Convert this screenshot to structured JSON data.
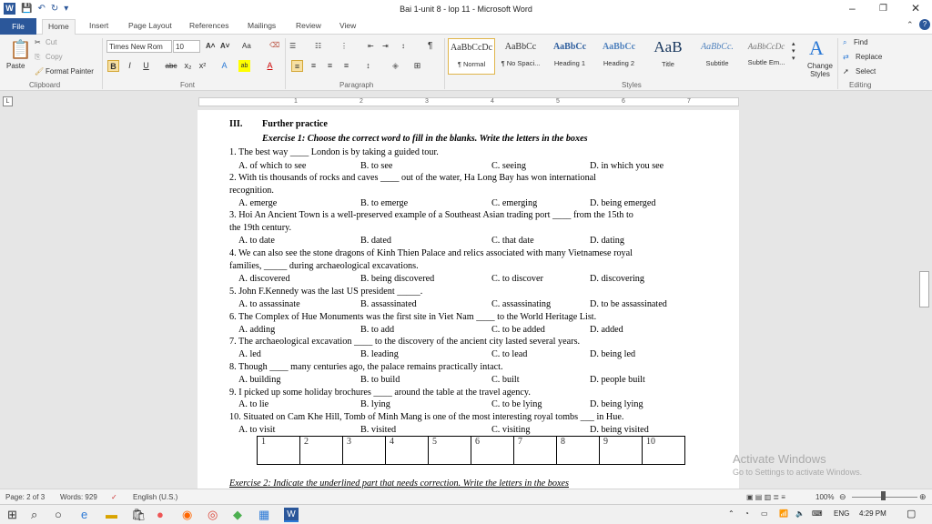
{
  "window": {
    "title": "Bai 1-unit 8 - lop 11  -  Microsoft Word",
    "minimize": "–",
    "restore": "❐",
    "close": "✕"
  },
  "tabs": [
    "File",
    "Home",
    "Insert",
    "Page Layout",
    "References",
    "Mailings",
    "Review",
    "View"
  ],
  "ribbon": {
    "clipboard": {
      "paste": "Paste",
      "cut": "Cut",
      "copy": "Copy",
      "format_painter": "Format Painter",
      "label": "Clipboard"
    },
    "font": {
      "name": "Times New Rom",
      "size": "10",
      "label": "Font",
      "grow": "A˄",
      "shrink": "A˅",
      "case": "Aa",
      "bold": "B",
      "italic": "I",
      "underline": "U",
      "strike": "abc",
      "sub": "x₂",
      "sup": "x²"
    },
    "paragraph": {
      "label": "Paragraph",
      "pilcrow": "¶"
    },
    "styles": {
      "label": "Styles",
      "items": [
        {
          "preview": "AaBbCcDc",
          "name": "¶ Normal"
        },
        {
          "preview": "AaBbCc",
          "name": "¶ No Spaci..."
        },
        {
          "preview": "AaBbCc",
          "name": "Heading 1"
        },
        {
          "preview": "AaBbCc",
          "name": "Heading 2"
        },
        {
          "preview": "AaB",
          "name": "Title"
        },
        {
          "preview": "AaBbCc.",
          "name": "Subtitle"
        },
        {
          "preview": "AaBbCcDc",
          "name": "Subtle Em..."
        }
      ],
      "change": "Change Styles"
    },
    "editing": {
      "label": "Editing",
      "find": "Find",
      "replace": "Replace",
      "select": "Select"
    }
  },
  "document": {
    "section_num": "III.",
    "section_title": "Further practice",
    "ex1": "Exercise 1: Choose the correct word to fill in the blanks. Write the letters in the boxes",
    "q1": "1. The best way ____ London is by taking a guided tour.",
    "q1o": [
      "A. of which to see",
      "B. to see",
      "C. seeing",
      "D. in which you see"
    ],
    "q2a": "2. With tis thousands of rocks and caves ____ out of the water, Ha Long Bay has won international",
    "q2b": "recognition.",
    "q2o": [
      "A. emerge",
      "B. to emerge",
      "C. emerging",
      "D. being emerged"
    ],
    "q3a": "3. Hoi An Ancient Town is a well-preserved example of a Southeast Asian  trading port ____ from the 15th to",
    "q3b": "the 19th century.",
    "q3o": [
      "A. to date",
      "B. dated",
      "C. that date",
      "D. dating"
    ],
    "q4a": "4. We can also see the stone dragons of Kinh Thien Palace and relics associated with many Vietnamese royal",
    "q4b": "families, _____ during archaeological excavations.",
    "q4o": [
      "A. discovered",
      "B. being discovered",
      "C. to discover",
      "D. discovering"
    ],
    "q5": "5. John F.Kennedy was the last US president _____.",
    "q5o": [
      "A. to assassinate",
      "B. assassinated",
      "C. assassinating",
      "D. to be assassinated"
    ],
    "q6": "6. The Complex of Hue Monuments was the first site in Viet Nam ____ to the World Heritage List.",
    "q6o": [
      "A. adding",
      "B. to add",
      "C. to be added",
      "D. added"
    ],
    "q7": "7. The archaeological  excavation ____ to the discovery of the ancient city lasted several years.",
    "q7o": [
      "A. led",
      "B. leading",
      "C. to lead",
      "D. being led"
    ],
    "q8": "8. Though ____ many centuries ago, the palace remains practically intact.",
    "q8o": [
      "A. building",
      "B. to build",
      "C. built",
      "D. people built"
    ],
    "q9": "9. I picked up some holiday brochures ____ around the table at the travel agency.",
    "q9o": [
      "A. to lie",
      "B. lying",
      "C. to be lying",
      "D. being lying"
    ],
    "q10": "10. Situated on Cam Khe Hill, Tomb of Minh Mang is one of the most interesting royal tombs ___ in Hue.",
    "q10o": [
      "A. to visit",
      "B. visited",
      "C. visiting",
      "D. being visited"
    ],
    "boxes": [
      "1",
      "2",
      "3",
      "4",
      "5",
      "6",
      "7",
      "8",
      "9",
      "10"
    ],
    "ex2": "Exercise 2: Indicate the underlined part that needs correction. Write the letters in the boxes"
  },
  "watermark": {
    "line1": "Activate Windows",
    "line2": "Go to Settings to activate Windows."
  },
  "status": {
    "page": "Page: 2 of 3",
    "words": "Words: 929",
    "lang": "English (U.S.)",
    "zoom": "100%"
  },
  "taskbar": {
    "lang": "ENG",
    "time": "4:29 PM"
  }
}
